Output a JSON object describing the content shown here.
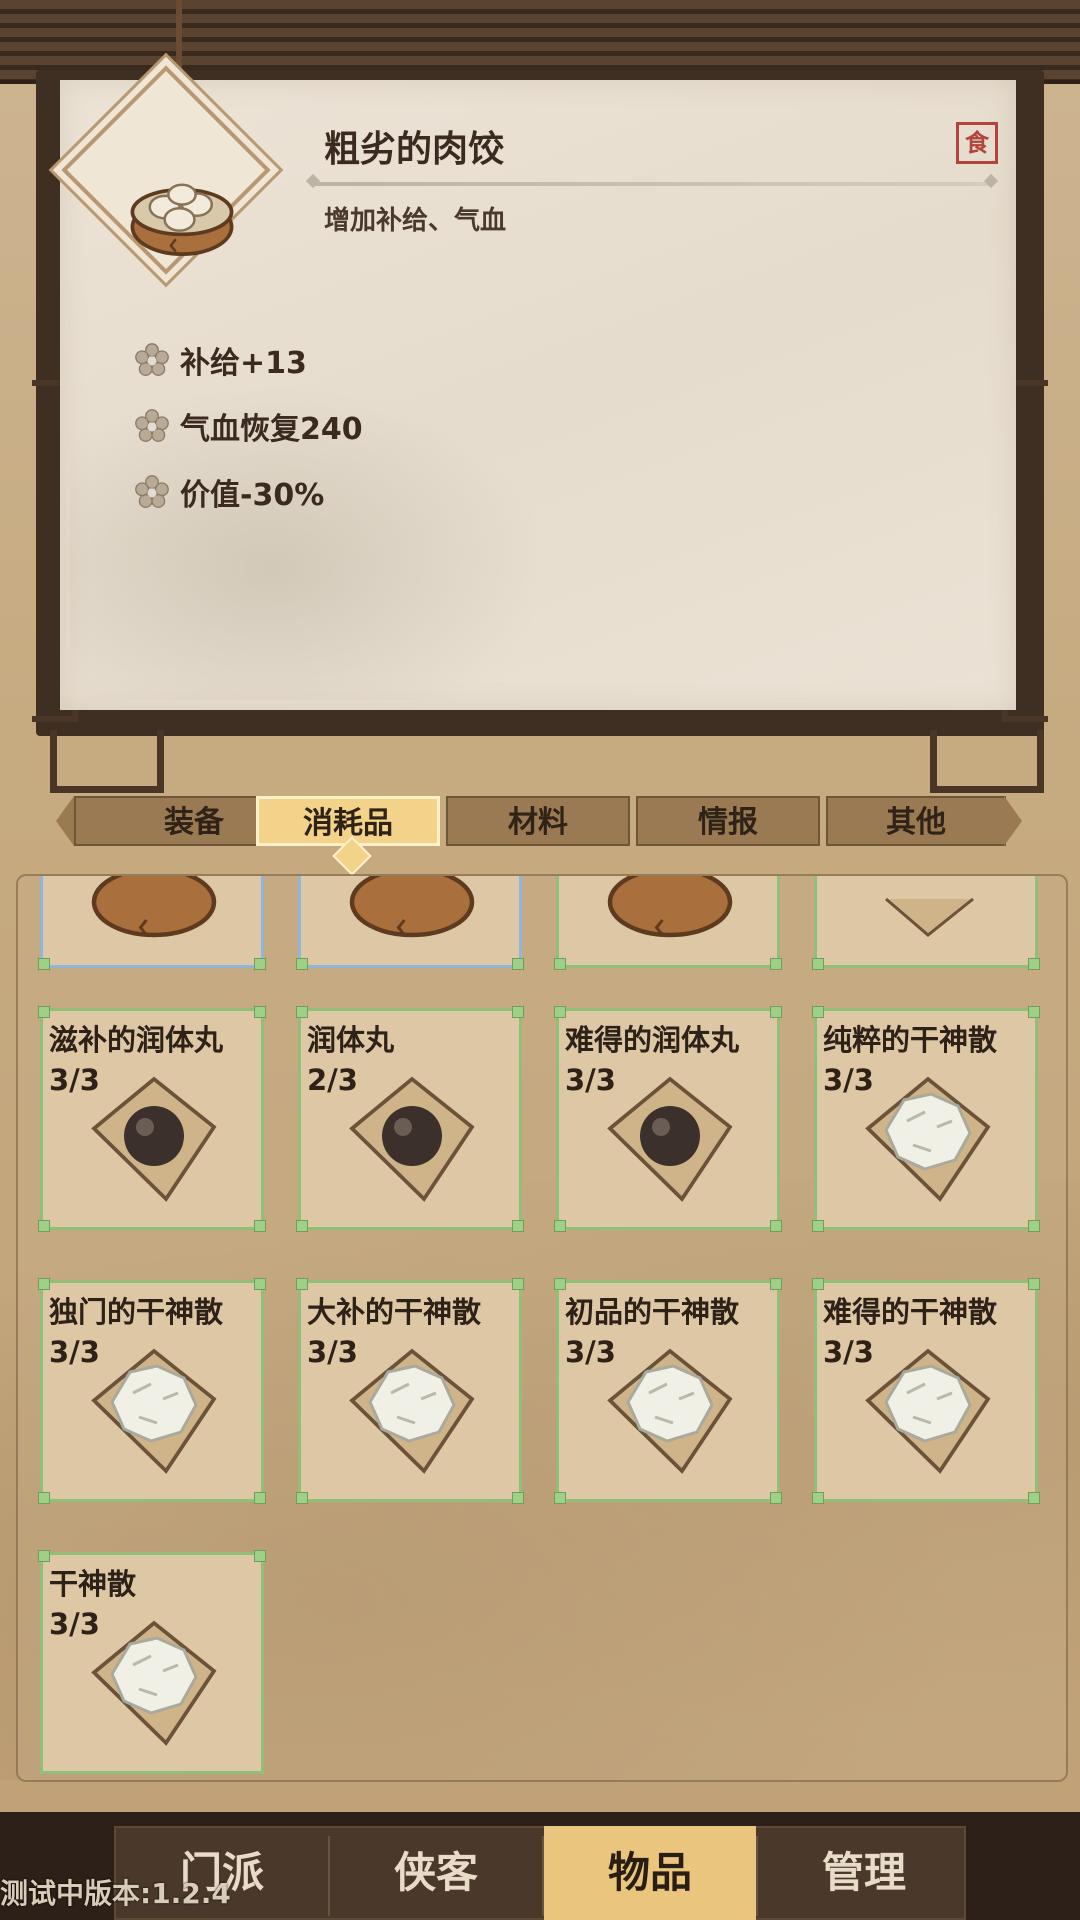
{
  "detail": {
    "title": "粗劣的肉饺",
    "type_badge": "食",
    "subtitle": "增加补给、气血",
    "item_icon": "steamed-dumpling-basket-icon",
    "stats": [
      {
        "text": "补给+13"
      },
      {
        "text": "气血恢复240"
      },
      {
        "text": "价值-30%"
      }
    ]
  },
  "tabs": [
    {
      "label": "装备",
      "active": false
    },
    {
      "label": "消耗品",
      "active": true
    },
    {
      "label": "材料",
      "active": false
    },
    {
      "label": "情报",
      "active": false
    },
    {
      "label": "其他",
      "active": false
    }
  ],
  "inventory": {
    "partial_row": [
      {
        "icon": "dumpling-basket-icon",
        "selected": true
      },
      {
        "icon": "dumpling-basket-icon",
        "selected": true
      },
      {
        "icon": "dumpling-basket-icon",
        "selected": false
      },
      {
        "icon": "powder-packet-icon",
        "selected": false
      }
    ],
    "items": [
      {
        "name": "滋补的润体丸",
        "count": "3/3",
        "icon": "black-pill-icon"
      },
      {
        "name": "润体丸",
        "count": "2/3",
        "icon": "black-pill-icon"
      },
      {
        "name": "难得的润体丸",
        "count": "3/3",
        "icon": "black-pill-icon"
      },
      {
        "name": "纯粹的干神散",
        "count": "3/3",
        "icon": "white-powder-icon"
      },
      {
        "name": "独门的干神散",
        "count": "3/3",
        "icon": "white-powder-icon"
      },
      {
        "name": "大补的干神散",
        "count": "3/3",
        "icon": "white-powder-icon"
      },
      {
        "name": "初品的干神散",
        "count": "3/3",
        "icon": "white-powder-icon"
      },
      {
        "name": "难得的干神散",
        "count": "3/3",
        "icon": "white-powder-icon"
      },
      {
        "name": "干神散",
        "count": "3/3",
        "icon": "white-powder-icon"
      }
    ]
  },
  "bottom_nav": [
    {
      "label": "门派",
      "active": false
    },
    {
      "label": "侠客",
      "active": false
    },
    {
      "label": "物品",
      "active": true
    },
    {
      "label": "管理",
      "active": false
    }
  ],
  "version_text": "测试中版本:1.2.4"
}
